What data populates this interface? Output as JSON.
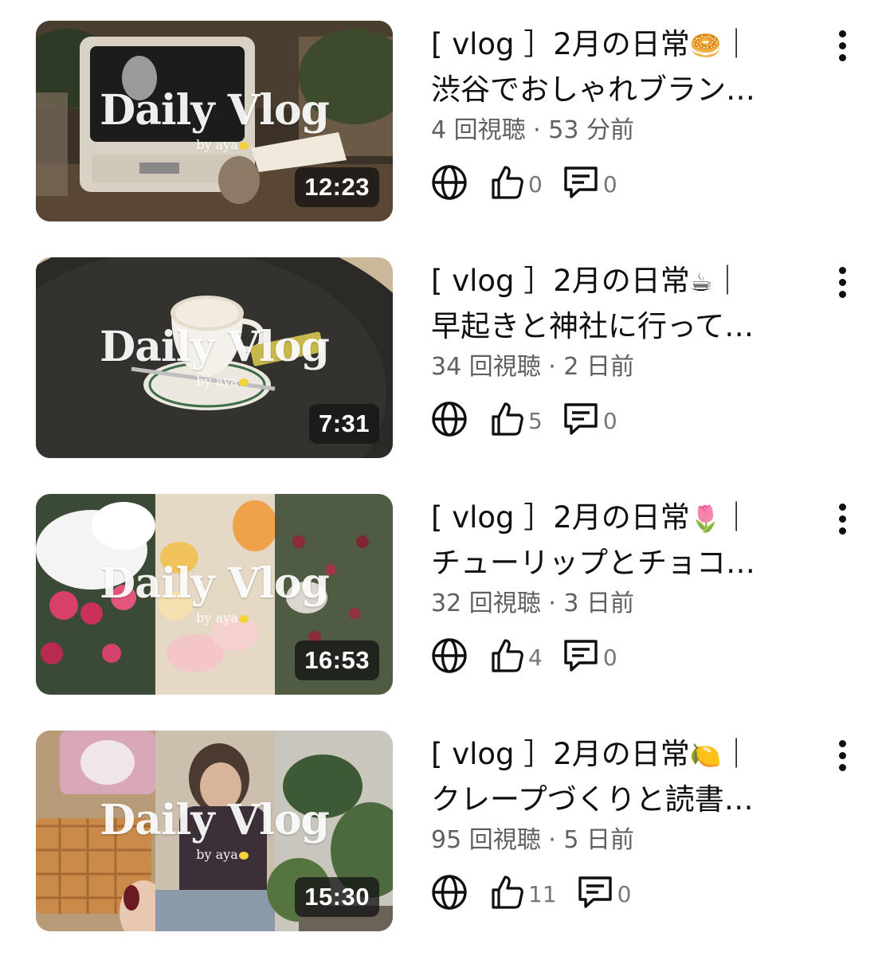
{
  "videos": [
    {
      "title_line1": "[ vlog ］2月の日常",
      "title_emoji": "🥯",
      "title_sep": "｜",
      "title_line2": "渋谷でおしゃれブラン…",
      "views": "4 回視聴",
      "ago": "53 分前",
      "likes": "0",
      "comments": "0",
      "duration": "12:23",
      "overlay_title": "Daily Vlog",
      "overlay_sub": "by aya"
    },
    {
      "title_line1": "[ vlog ］2月の日常",
      "title_emoji": "☕",
      "title_sep": "｜",
      "title_line2": "早起きと神社に行って…",
      "views": "34 回視聴",
      "ago": "2 日前",
      "likes": "5",
      "comments": "0",
      "duration": "7:31",
      "overlay_title": "Daily Vlog",
      "overlay_sub": "by aya"
    },
    {
      "title_line1": "[ vlog ］2月の日常",
      "title_emoji": "🌷",
      "title_sep": "｜",
      "title_line2": "チューリップとチョコ…",
      "views": "32 回視聴",
      "ago": "3 日前",
      "likes": "4",
      "comments": "0",
      "duration": "16:53",
      "overlay_title": "Daily Vlog",
      "overlay_sub": "by aya"
    },
    {
      "title_line1": "[ vlog ］2月の日常",
      "title_emoji": "🍋",
      "title_sep": "｜",
      "title_line2": "クレープづくりと読書…",
      "views": "95 回視聴",
      "ago": "5 日前",
      "likes": "11",
      "comments": "0",
      "duration": "15:30",
      "overlay_title": "Daily Vlog",
      "overlay_sub": "by aya"
    }
  ],
  "stat_separator": "·",
  "icons": {
    "visibility": "globe-icon",
    "like": "thumbs-up-icon",
    "comment": "comment-icon",
    "menu": "kebab-menu-icon"
  },
  "colors": {
    "text_primary": "#0f0f0f",
    "text_secondary": "#606060",
    "duration_badge": "#141414"
  }
}
